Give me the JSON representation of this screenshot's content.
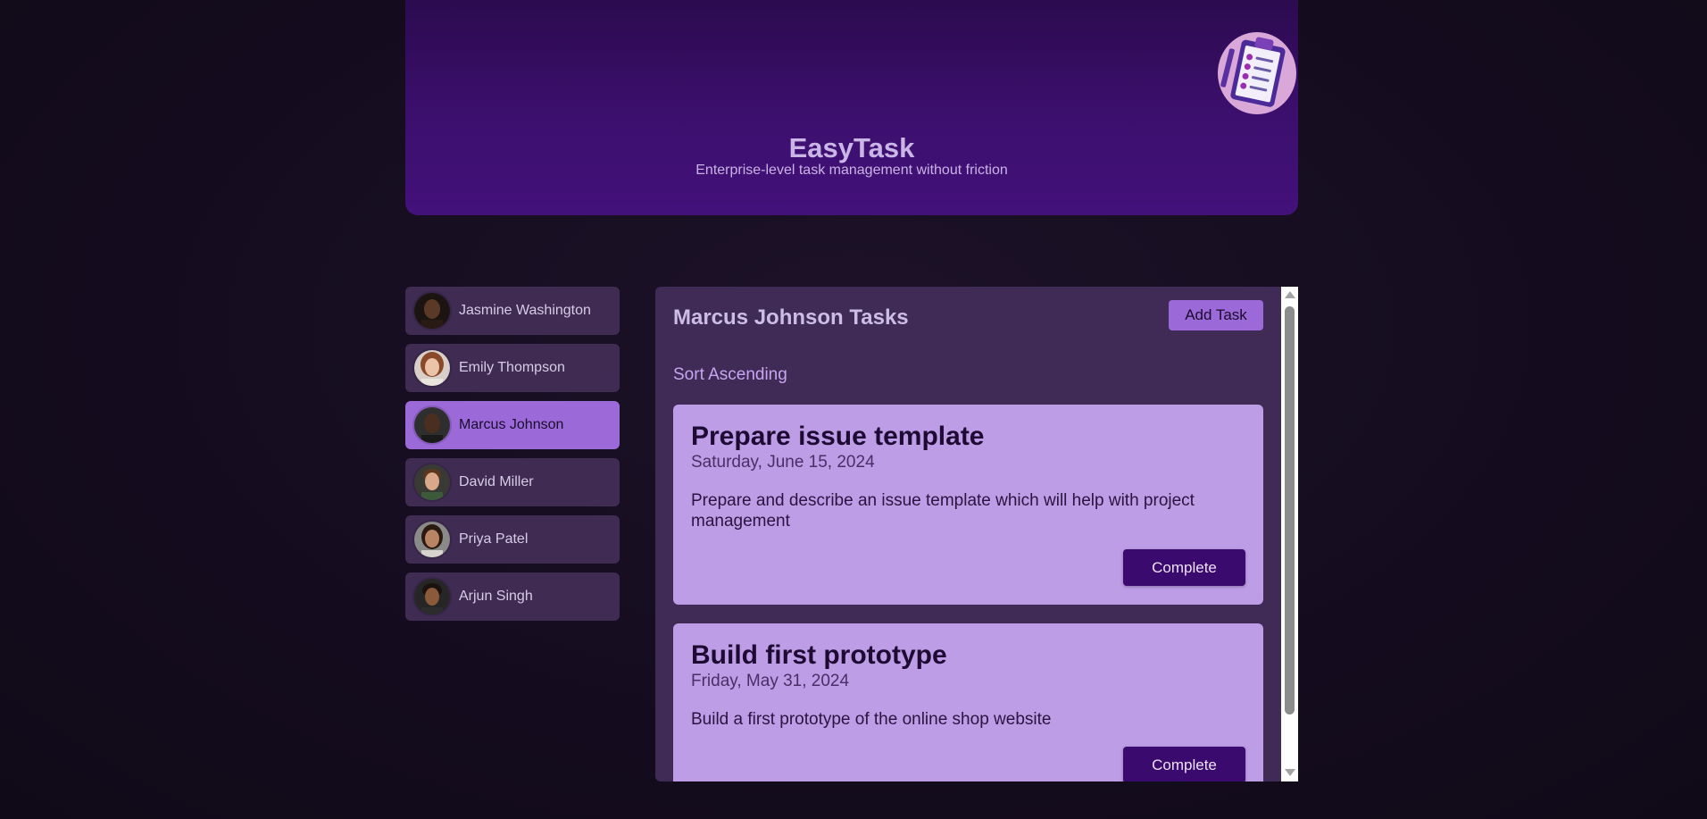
{
  "header": {
    "app_title": "EasyTask",
    "subtitle": "Enterprise-level task management without friction",
    "logo_icon": "clipboard-checklist-icon"
  },
  "sidebar": {
    "users": [
      {
        "name": "Jasmine Washington",
        "active": false
      },
      {
        "name": "Emily Thompson",
        "active": false
      },
      {
        "name": "Marcus Johnson",
        "active": true
      },
      {
        "name": "David Miller",
        "active": false
      },
      {
        "name": "Priya Patel",
        "active": false
      },
      {
        "name": "Arjun Singh",
        "active": false
      }
    ]
  },
  "main": {
    "title": "Marcus Johnson Tasks",
    "add_task_label": "Add Task",
    "sort_label": "Sort Ascending",
    "tasks": [
      {
        "title": "Prepare issue template",
        "date": "Saturday, June 15, 2024",
        "description": "Prepare and describe an issue template which will help with project management",
        "complete_label": "Complete"
      },
      {
        "title": "Build first prototype",
        "date": "Friday, May 31, 2024",
        "description": "Build a first prototype of the online shop website",
        "complete_label": "Complete"
      }
    ]
  },
  "colors": {
    "accent": "#9b6ad8",
    "header_bg": "#3c0f6e",
    "card_bg": "#bd9de6",
    "button_dark": "#3b0a6e",
    "page_bg": "#140c1e"
  }
}
